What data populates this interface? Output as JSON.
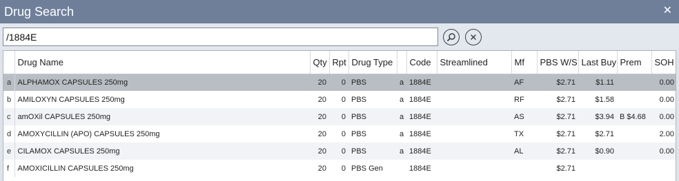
{
  "window": {
    "title": "Drug Search",
    "close_glyph": "✕"
  },
  "search": {
    "value": "/1884E"
  },
  "icons": {
    "search": "search-icon",
    "clear": "clear-icon",
    "close": "close-icon"
  },
  "columns": {
    "drug_name": "Drug Name",
    "qty": "Qty",
    "rpt": "Rpt",
    "drug_type": "Drug Type",
    "code": "Code",
    "streamlined": "Streamlined",
    "mf": "Mf",
    "pbs_ws": "PBS W/S",
    "last_buy": "Last Buy",
    "prem": "Prem",
    "soh": "SOH"
  },
  "rows": [
    {
      "key": "a",
      "name": "ALPHAMOX CAPSULES 250mg",
      "qty": "20",
      "rpt": "0",
      "type": "PBS",
      "flag": "a",
      "code": "1884E",
      "streamlined": "",
      "mf": "AF",
      "pbs_ws": "$2.71",
      "last_buy": "$1.11",
      "prem": "",
      "soh": "0.00"
    },
    {
      "key": "b",
      "name": "AMILOXYN CAPSULES 250mg",
      "qty": "20",
      "rpt": "0",
      "type": "PBS",
      "flag": "a",
      "code": "1884E",
      "streamlined": "",
      "mf": "RF",
      "pbs_ws": "$2.71",
      "last_buy": "$1.58",
      "prem": "",
      "soh": "0.00"
    },
    {
      "key": "c",
      "name": "amOXil CAPSULES 250mg",
      "qty": "20",
      "rpt": "0",
      "type": "PBS",
      "flag": "a",
      "code": "1884E",
      "streamlined": "",
      "mf": "AS",
      "pbs_ws": "$2.71",
      "last_buy": "$3.94",
      "prem": "B $4.68",
      "soh": "0.00"
    },
    {
      "key": "d",
      "name": "AMOXYCILLIN (APO) CAPSULES 250mg",
      "qty": "20",
      "rpt": "0",
      "type": "PBS",
      "flag": "a",
      "code": "1884E",
      "streamlined": "",
      "mf": "TX",
      "pbs_ws": "$2.71",
      "last_buy": "$2.71",
      "prem": "",
      "soh": "2.00"
    },
    {
      "key": "e",
      "name": "CILAMOX CAPSULES 250mg",
      "qty": "20",
      "rpt": "0",
      "type": "PBS",
      "flag": "a",
      "code": "1884E",
      "streamlined": "",
      "mf": "AL",
      "pbs_ws": "$2.71",
      "last_buy": "$0.90",
      "prem": "",
      "soh": "0.00"
    },
    {
      "key": "f",
      "name": "AMOXICILLIN CAPSULES 250mg",
      "qty": "20",
      "rpt": "0",
      "type": "PBS Gen",
      "flag": "",
      "code": "1884E",
      "streamlined": "",
      "mf": "",
      "pbs_ws": "$2.71",
      "last_buy": "",
      "prem": "",
      "soh": ""
    }
  ],
  "selected_row": 0
}
